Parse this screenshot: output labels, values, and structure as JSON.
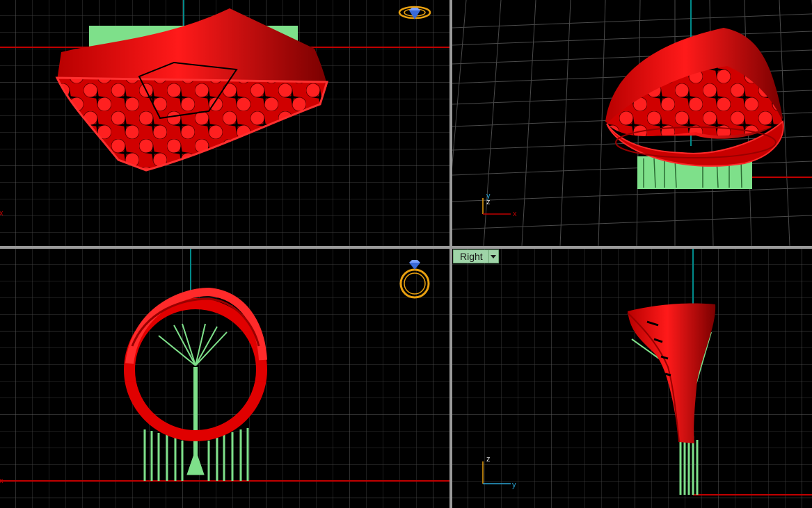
{
  "viewports": {
    "top": {
      "name": ""
    },
    "perspective": {
      "name": "",
      "axes": {
        "x": "x",
        "y": "y",
        "z": "z"
      }
    },
    "front": {
      "name": ""
    },
    "right": {
      "name": "Right",
      "axes": {
        "z": "z",
        "y": "y"
      }
    }
  },
  "colors": {
    "background": "#000000",
    "grid": "#3a3a3a",
    "grid_major": "#5a5a5a",
    "x_axis": "#c00000",
    "y_axis": "#008a8a",
    "model": "#e00000",
    "supports": "#7ee08a",
    "widget": "#e8a010",
    "label_bg": "#9fd4a8"
  },
  "icons": {
    "navigation_widget_top": "ring-widget-icon",
    "navigation_widget_front": "ring-widget-icon"
  }
}
